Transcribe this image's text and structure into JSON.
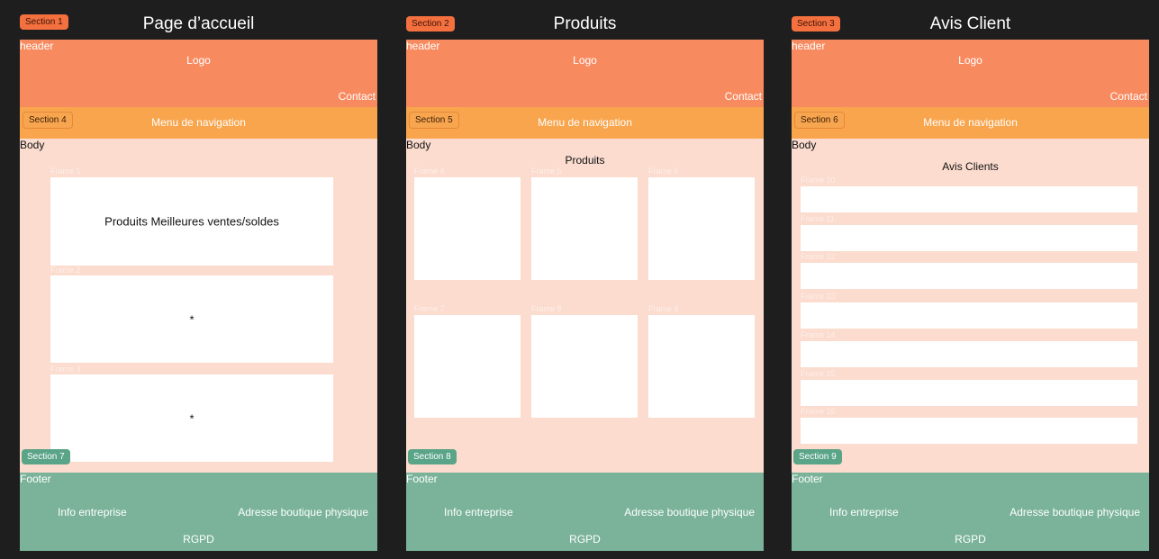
{
  "pages": [
    {
      "title": "Page d’accueil",
      "title_badge": "Section 1",
      "header": {
        "label": "header",
        "logo": "Logo",
        "contact": "Contact"
      },
      "nav": {
        "badge": "Section 4",
        "label": "Menu de navigation"
      },
      "body": {
        "label": "Body",
        "frames": [
          {
            "label": "Frame 1",
            "text": "Produits Meilleures ventes/soldes"
          },
          {
            "label": "Frame 2",
            "text": "*"
          },
          {
            "label": "Frame 3",
            "text": "*"
          }
        ]
      },
      "footer": {
        "badge": "Section 7",
        "label": "Footer",
        "info": "Info entreprise",
        "address": "Adresse boutique physique",
        "rgpd": "RGPD"
      }
    },
    {
      "title": "Produits",
      "title_badge": "Section 2",
      "header": {
        "label": "header",
        "logo": "Logo",
        "contact": "Contact"
      },
      "nav": {
        "badge": "Section 5",
        "label": "Menu de navigation"
      },
      "body": {
        "label": "Body",
        "title": "Produits",
        "frames": [
          {
            "label": "Frame 4"
          },
          {
            "label": "Frame 5"
          },
          {
            "label": "Frame 6"
          },
          {
            "label": "Frame 7"
          },
          {
            "label": "Frame 8"
          },
          {
            "label": "Frame 9"
          }
        ]
      },
      "footer": {
        "badge": "Section 8",
        "label": "Footer",
        "info": "Info entreprise",
        "address": "Adresse boutique physique",
        "rgpd": "RGPD"
      }
    },
    {
      "title": "Avis Client",
      "title_badge": "Section 3",
      "header": {
        "label": "header",
        "logo": "Logo",
        "contact": "Contact"
      },
      "nav": {
        "badge": "Section 6",
        "label": "Menu de navigation"
      },
      "body": {
        "label": "Body",
        "title": "Avis Clients",
        "frames": [
          {
            "label": "Frame 10"
          },
          {
            "label": "Frame 11"
          },
          {
            "label": "Frame 12"
          },
          {
            "label": "Frame 13"
          },
          {
            "label": "Frame 14"
          },
          {
            "label": "Frame 15"
          },
          {
            "label": "Frame 16"
          }
        ]
      },
      "footer": {
        "badge": "Section 9",
        "label": "Footer",
        "info": "Info entreprise",
        "address": "Adresse boutique physique",
        "rgpd": "RGPD"
      }
    }
  ]
}
